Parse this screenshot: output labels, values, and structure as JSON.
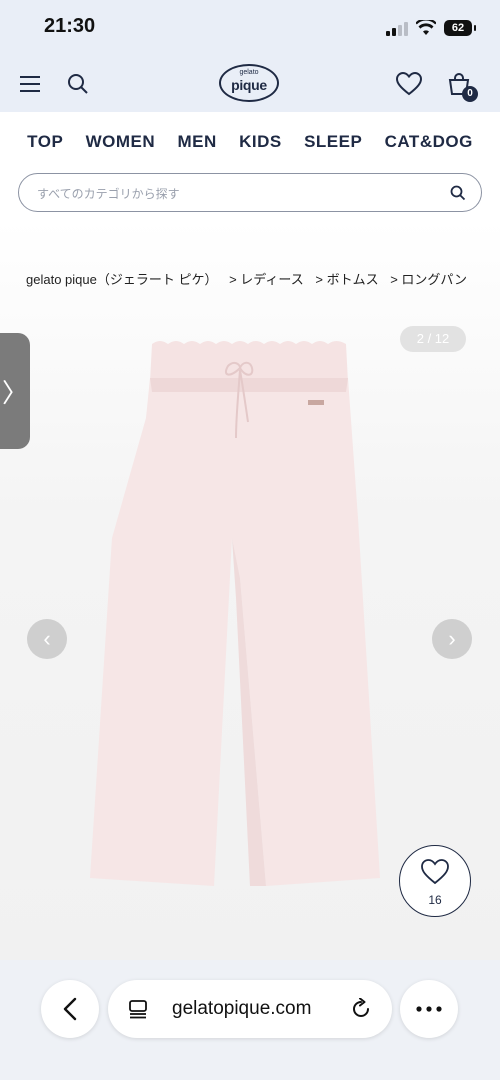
{
  "status": {
    "time": "21:30",
    "battery": "62",
    "icons": [
      "cellular-signal-icon",
      "wifi-icon",
      "battery-icon"
    ]
  },
  "header": {
    "logo_top": "gelato",
    "logo_main": "pique",
    "cart_count": "0",
    "icons": [
      "menu-icon",
      "search-icon",
      "heart-icon",
      "cart-icon"
    ]
  },
  "nav": {
    "items": [
      "TOP",
      "WOMEN",
      "MEN",
      "KIDS",
      "SLEEP",
      "CAT&DOG"
    ]
  },
  "search": {
    "placeholder": "すべてのカテゴリから探す"
  },
  "breadcrumb": [
    "gelato pique（ジェラート ピケ）",
    "> レディース",
    "> ボトムス",
    "> ロングパン"
  ],
  "gallery": {
    "pager": "2 / 12",
    "side_tab_glyph": "〉",
    "prev_glyph": "‹",
    "next_glyph": "›",
    "product_color": "#f6e6e6"
  },
  "favorite": {
    "count": "16"
  },
  "browser": {
    "url": "gelatopique.com",
    "icons": [
      "back-arrow-icon",
      "tabs-icon",
      "reload-icon",
      "more-icon"
    ]
  },
  "colors": {
    "brand": "#1f2a44",
    "header_bg": "#e9eef7",
    "browser_bg": "#eef1f6"
  }
}
